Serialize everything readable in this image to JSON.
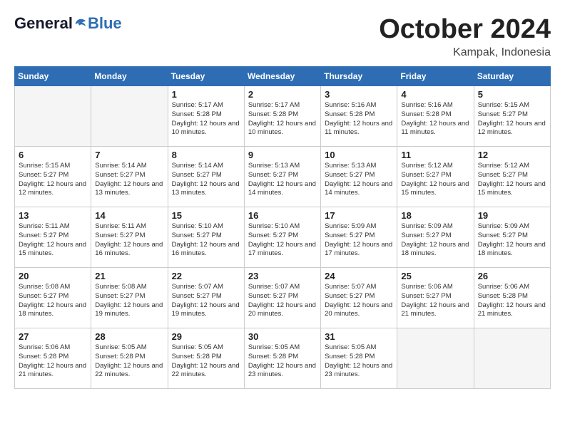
{
  "header": {
    "logo_line1": "General",
    "logo_line2": "Blue",
    "month": "October 2024",
    "location": "Kampak, Indonesia"
  },
  "days_of_week": [
    "Sunday",
    "Monday",
    "Tuesday",
    "Wednesday",
    "Thursday",
    "Friday",
    "Saturday"
  ],
  "weeks": [
    [
      {
        "day": "",
        "empty": true
      },
      {
        "day": "",
        "empty": true
      },
      {
        "day": "1",
        "sunrise": "5:17 AM",
        "sunset": "5:28 PM",
        "daylight": "12 hours and 10 minutes."
      },
      {
        "day": "2",
        "sunrise": "5:17 AM",
        "sunset": "5:28 PM",
        "daylight": "12 hours and 10 minutes."
      },
      {
        "day": "3",
        "sunrise": "5:16 AM",
        "sunset": "5:28 PM",
        "daylight": "12 hours and 11 minutes."
      },
      {
        "day": "4",
        "sunrise": "5:16 AM",
        "sunset": "5:28 PM",
        "daylight": "12 hours and 11 minutes."
      },
      {
        "day": "5",
        "sunrise": "5:15 AM",
        "sunset": "5:27 PM",
        "daylight": "12 hours and 12 minutes."
      }
    ],
    [
      {
        "day": "6",
        "sunrise": "5:15 AM",
        "sunset": "5:27 PM",
        "daylight": "12 hours and 12 minutes."
      },
      {
        "day": "7",
        "sunrise": "5:14 AM",
        "sunset": "5:27 PM",
        "daylight": "12 hours and 13 minutes."
      },
      {
        "day": "8",
        "sunrise": "5:14 AM",
        "sunset": "5:27 PM",
        "daylight": "12 hours and 13 minutes."
      },
      {
        "day": "9",
        "sunrise": "5:13 AM",
        "sunset": "5:27 PM",
        "daylight": "12 hours and 14 minutes."
      },
      {
        "day": "10",
        "sunrise": "5:13 AM",
        "sunset": "5:27 PM",
        "daylight": "12 hours and 14 minutes."
      },
      {
        "day": "11",
        "sunrise": "5:12 AM",
        "sunset": "5:27 PM",
        "daylight": "12 hours and 15 minutes."
      },
      {
        "day": "12",
        "sunrise": "5:12 AM",
        "sunset": "5:27 PM",
        "daylight": "12 hours and 15 minutes."
      }
    ],
    [
      {
        "day": "13",
        "sunrise": "5:11 AM",
        "sunset": "5:27 PM",
        "daylight": "12 hours and 15 minutes."
      },
      {
        "day": "14",
        "sunrise": "5:11 AM",
        "sunset": "5:27 PM",
        "daylight": "12 hours and 16 minutes."
      },
      {
        "day": "15",
        "sunrise": "5:10 AM",
        "sunset": "5:27 PM",
        "daylight": "12 hours and 16 minutes."
      },
      {
        "day": "16",
        "sunrise": "5:10 AM",
        "sunset": "5:27 PM",
        "daylight": "12 hours and 17 minutes."
      },
      {
        "day": "17",
        "sunrise": "5:09 AM",
        "sunset": "5:27 PM",
        "daylight": "12 hours and 17 minutes."
      },
      {
        "day": "18",
        "sunrise": "5:09 AM",
        "sunset": "5:27 PM",
        "daylight": "12 hours and 18 minutes."
      },
      {
        "day": "19",
        "sunrise": "5:09 AM",
        "sunset": "5:27 PM",
        "daylight": "12 hours and 18 minutes."
      }
    ],
    [
      {
        "day": "20",
        "sunrise": "5:08 AM",
        "sunset": "5:27 PM",
        "daylight": "12 hours and 18 minutes."
      },
      {
        "day": "21",
        "sunrise": "5:08 AM",
        "sunset": "5:27 PM",
        "daylight": "12 hours and 19 minutes."
      },
      {
        "day": "22",
        "sunrise": "5:07 AM",
        "sunset": "5:27 PM",
        "daylight": "12 hours and 19 minutes."
      },
      {
        "day": "23",
        "sunrise": "5:07 AM",
        "sunset": "5:27 PM",
        "daylight": "12 hours and 20 minutes."
      },
      {
        "day": "24",
        "sunrise": "5:07 AM",
        "sunset": "5:27 PM",
        "daylight": "12 hours and 20 minutes."
      },
      {
        "day": "25",
        "sunrise": "5:06 AM",
        "sunset": "5:27 PM",
        "daylight": "12 hours and 21 minutes."
      },
      {
        "day": "26",
        "sunrise": "5:06 AM",
        "sunset": "5:28 PM",
        "daylight": "12 hours and 21 minutes."
      }
    ],
    [
      {
        "day": "27",
        "sunrise": "5:06 AM",
        "sunset": "5:28 PM",
        "daylight": "12 hours and 21 minutes."
      },
      {
        "day": "28",
        "sunrise": "5:05 AM",
        "sunset": "5:28 PM",
        "daylight": "12 hours and 22 minutes."
      },
      {
        "day": "29",
        "sunrise": "5:05 AM",
        "sunset": "5:28 PM",
        "daylight": "12 hours and 22 minutes."
      },
      {
        "day": "30",
        "sunrise": "5:05 AM",
        "sunset": "5:28 PM",
        "daylight": "12 hours and 23 minutes."
      },
      {
        "day": "31",
        "sunrise": "5:05 AM",
        "sunset": "5:28 PM",
        "daylight": "12 hours and 23 minutes."
      },
      {
        "day": "",
        "empty": true
      },
      {
        "day": "",
        "empty": true
      }
    ]
  ]
}
